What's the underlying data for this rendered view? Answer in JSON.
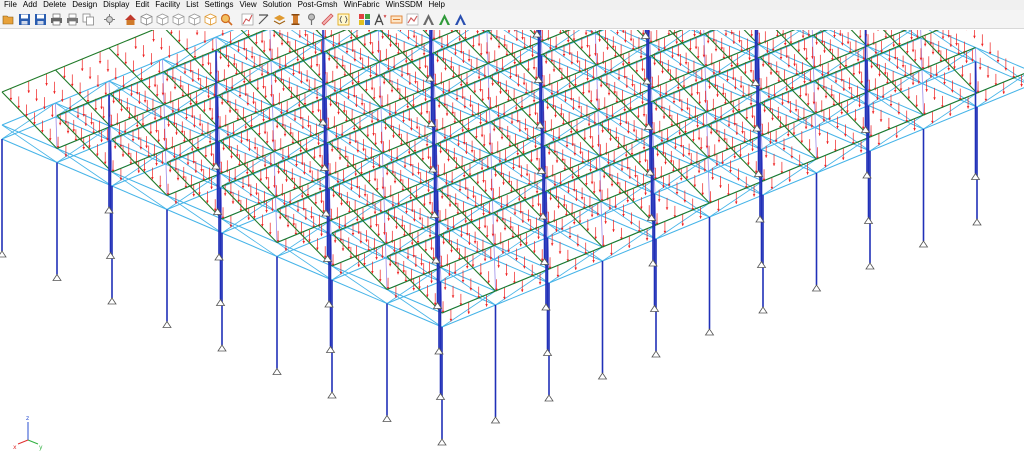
{
  "menu": {
    "items": [
      "File",
      "Add",
      "Delete",
      "Design",
      "Display",
      "Edit",
      "Facility",
      "List",
      "Settings",
      "View",
      "Solution",
      "Post-Gmsh",
      "WinFabric",
      "WinSSDM",
      "Help"
    ]
  },
  "toolbar": {
    "buttons": [
      {
        "name": "open-folder-icon",
        "color": "#e8a23a"
      },
      {
        "name": "save-icon",
        "color": "#2a5db0"
      },
      {
        "name": "save-as-icon",
        "color": "#2a5db0"
      },
      {
        "name": "print-icon",
        "color": "#666666"
      },
      {
        "name": "print-preview-icon",
        "color": "#777777"
      },
      {
        "name": "copy-icon",
        "color": "#888888"
      },
      {
        "name": "sep"
      },
      {
        "name": "wizard-icon",
        "color": "#7a7a7a"
      },
      {
        "name": "sep"
      },
      {
        "name": "house-icon",
        "color": "#d07a2a"
      },
      {
        "name": "cube-icon",
        "color": "#8a8a8a"
      },
      {
        "name": "cube-outline-icon",
        "color": "#9a9a9a"
      },
      {
        "name": "cube-front-icon",
        "color": "#9a9a9a"
      },
      {
        "name": "cube-side-icon",
        "color": "#9a9a9a"
      },
      {
        "name": "cube-color-icon",
        "color": "#e09a30"
      },
      {
        "name": "zoom-icon",
        "color": "#d06a20"
      },
      {
        "name": "sep"
      },
      {
        "name": "chart-icon",
        "color": "#d05050"
      },
      {
        "name": "diagonal-icon",
        "color": "#555555"
      },
      {
        "name": "layers-icon",
        "color": "#e09a30"
      },
      {
        "name": "column-icon",
        "color": "#d07a2a"
      },
      {
        "name": "pin-icon",
        "color": "#707070"
      },
      {
        "name": "ruler-icon",
        "color": "#d05050"
      },
      {
        "name": "bracket-icon",
        "color": "#e0a000"
      },
      {
        "name": "sep"
      },
      {
        "name": "grid-color-icon",
        "color": "#3a70c0"
      },
      {
        "name": "text-format-icon",
        "color": "#444444"
      },
      {
        "name": "label-icon",
        "color": "#e08030"
      },
      {
        "name": "image-icon",
        "color": "#d06060"
      },
      {
        "name": "letter-a-gray-icon",
        "color": "#6a6a6a"
      },
      {
        "name": "letter-a-green-icon",
        "color": "#2f9a3a"
      },
      {
        "name": "letter-a-blue-icon",
        "color": "#2a4fb0"
      }
    ]
  },
  "axes": {
    "x_label": "x",
    "y_label": "y",
    "z_label": "z"
  },
  "colors": {
    "load_arrow": "#ef2020",
    "rafter": "#1f7a28",
    "truss": "#46b4e8",
    "column": "#2030b8",
    "purlin": "#9a8ae8",
    "support": "#555555"
  }
}
